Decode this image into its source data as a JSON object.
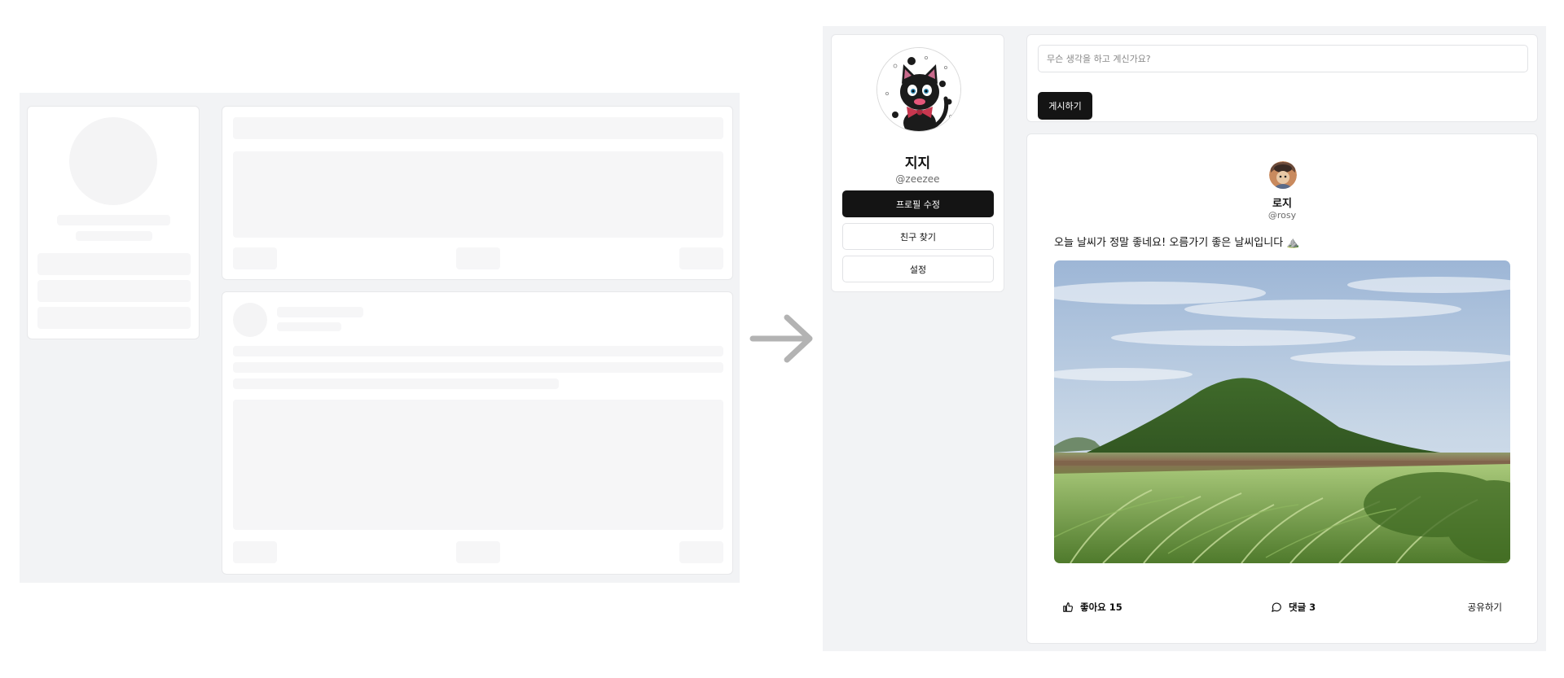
{
  "profile": {
    "name": "지지",
    "handle": "@zeezee",
    "buttons": {
      "edit_profile": "프로필 수정",
      "find_friends": "친구 찾기",
      "settings": "설정"
    }
  },
  "composer": {
    "placeholder": "무슨 생각을 하고 계신가요?",
    "submit_label": "게시하기"
  },
  "post": {
    "author_name": "로지",
    "author_handle": "@rosy",
    "text": "오늘 날씨가 정말 좋네요! 오름가기 좋은 날씨입니다 ⛰️",
    "actions": {
      "like_label": "좋아요 15",
      "comment_label": "댓글 3",
      "share_label": "공유하기"
    }
  },
  "icons": {
    "like": "thumbs-up-icon",
    "comment": "speech-bubble-icon",
    "transition": "arrow-right-icon"
  },
  "colors": {
    "primary_button": "#141414",
    "page_background": "#f2f3f5",
    "skeleton": "#f6f6f7"
  }
}
